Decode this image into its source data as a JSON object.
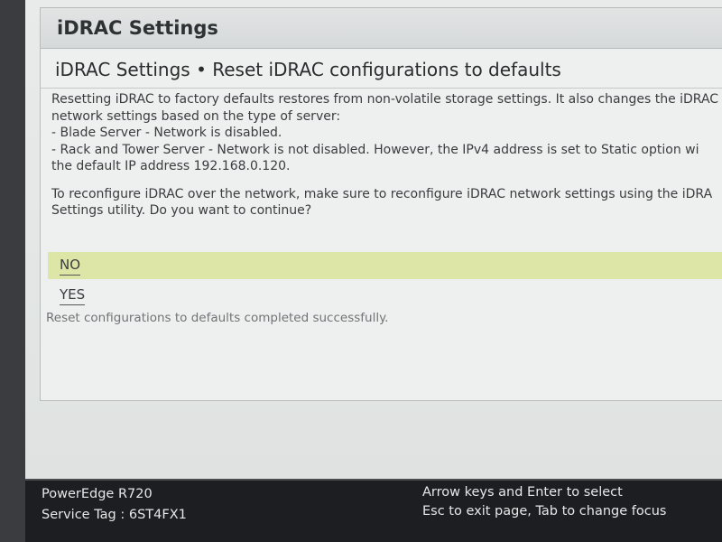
{
  "window": {
    "title": "iDRAC Settings"
  },
  "page": {
    "heading": "iDRAC Settings • Reset iDRAC configurations to defaults"
  },
  "message": {
    "lines": [
      "Resetting iDRAC to factory defaults restores from non-volatile storage settings. It also changes the iDRAC",
      "network settings based on the type of server:",
      "-  Blade Server - Network is disabled.",
      "-  Rack and Tower Server - Network is not disabled. However, the IPv4 address is set to Static option wi",
      "the default IP address 192.168.0.120."
    ],
    "question_lines": [
      "To reconfigure iDRAC over the network, make sure to reconfigure iDRAC network settings using the iDRA",
      "Settings utility. Do you want to continue?"
    ]
  },
  "options": {
    "no_label": "NO",
    "yes_label": "YES"
  },
  "status": {
    "text": "Reset configurations to defaults completed successfully."
  },
  "footer": {
    "model": "PowerEdge R720",
    "service_tag": "Service Tag : 6ST4FX1",
    "hint_select": "Arrow keys and Enter to select",
    "hint_exit": "Esc to exit page, Tab to change focus"
  },
  "colors": {
    "highlight": "#dde6a6",
    "footer_bg": "#1c1e21"
  }
}
